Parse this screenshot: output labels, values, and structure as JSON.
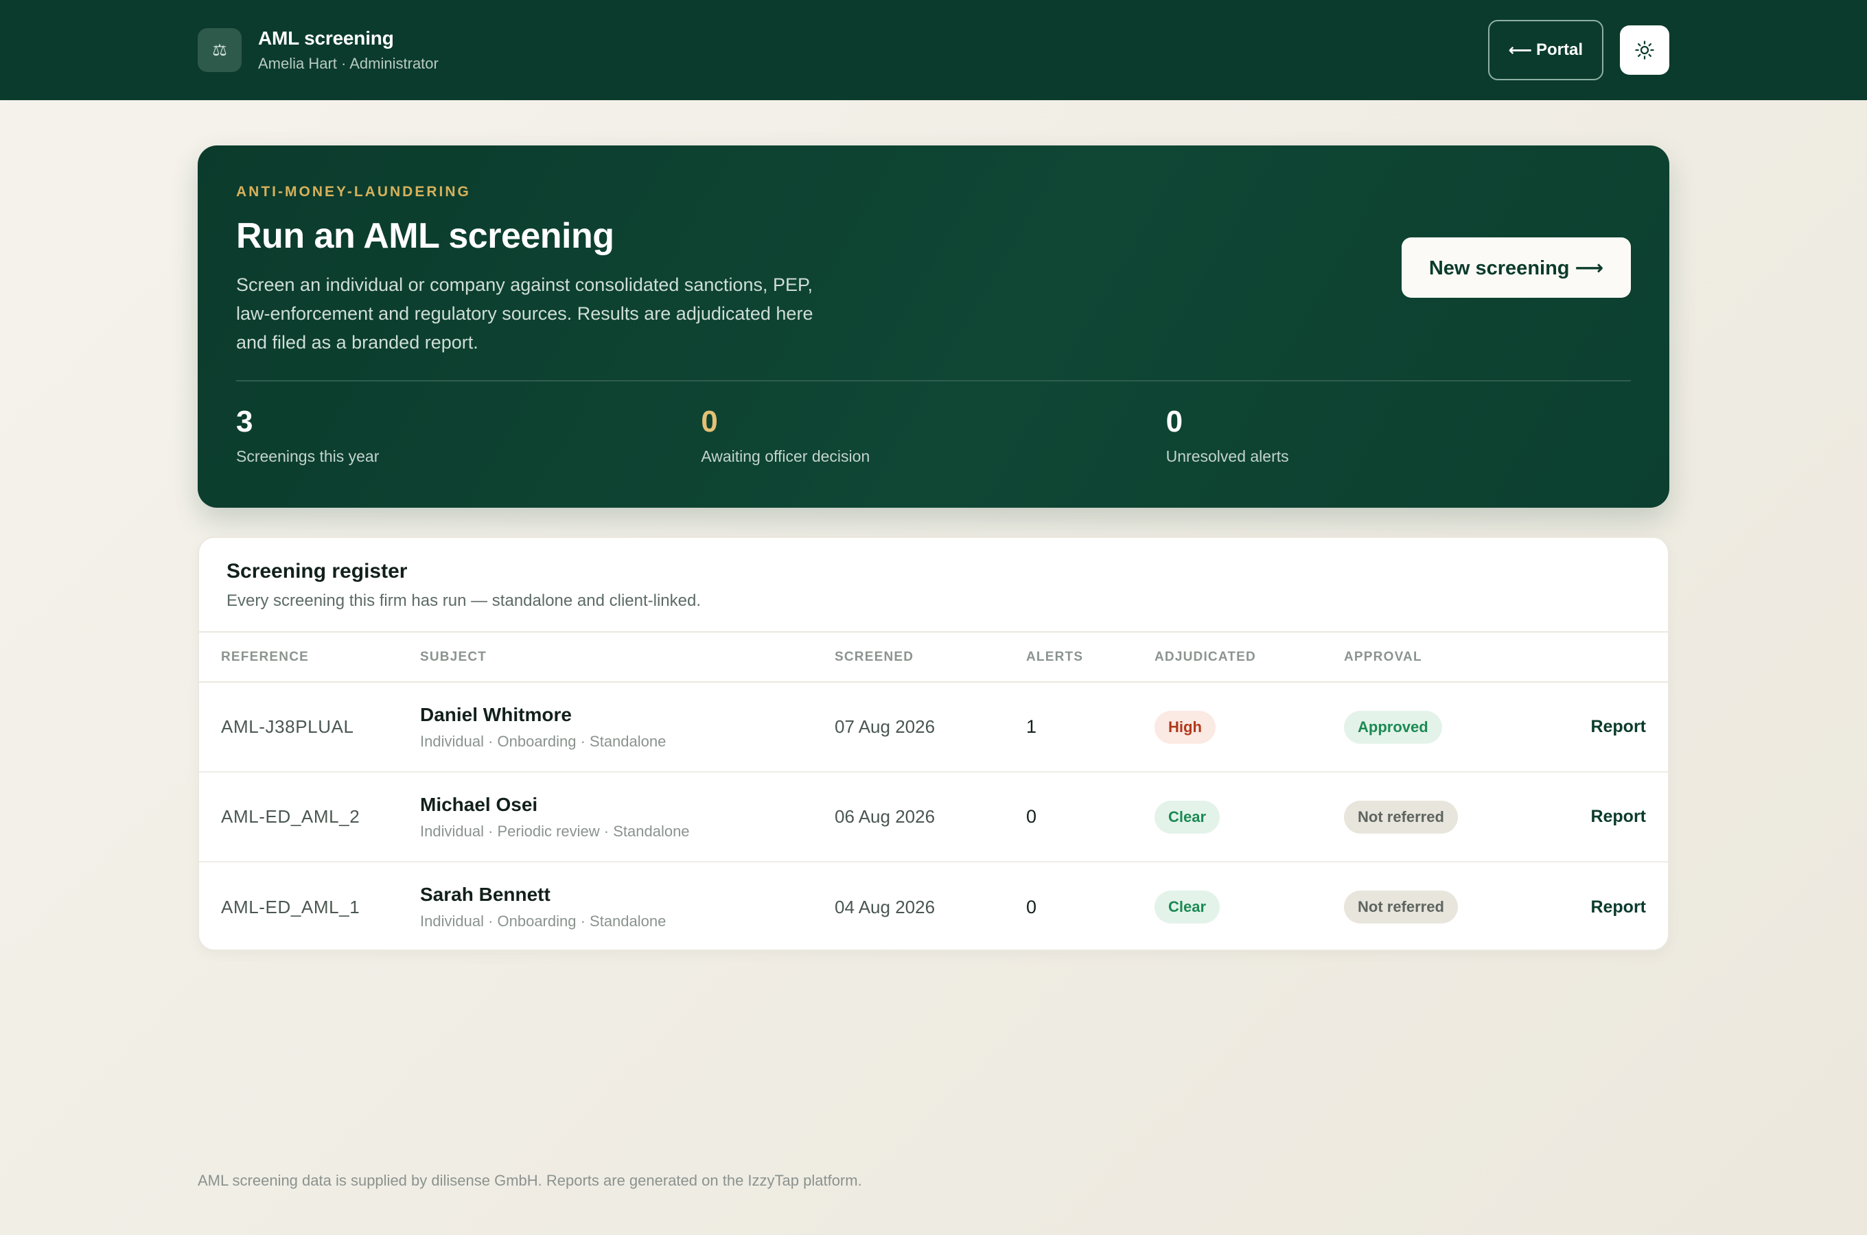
{
  "header": {
    "title": "AML screening",
    "subtitle": "Amelia Hart · Administrator",
    "badge_icon": "⚖",
    "portal_label": "Portal",
    "portal_arrow": "⟵"
  },
  "hero": {
    "eyebrow": "ANTI-MONEY-LAUNDERING",
    "title": "Run an AML screening",
    "description": "Screen an individual or company against consolidated sanctions, PEP, law-enforcement and regulatory sources. Results are adjudicated here and filed as a branded report.",
    "new_button": "New screening ⟶",
    "stats": [
      {
        "value": "3",
        "label": "Screenings this year"
      },
      {
        "value": "0",
        "label": "Awaiting officer decision"
      },
      {
        "value": "0",
        "label": "Unresolved alerts"
      }
    ]
  },
  "register": {
    "title": "Screening register",
    "subtitle": "Every screening this firm has run — standalone and client-linked.",
    "columns": [
      "REFERENCE",
      "SUBJECT",
      "SCREENED",
      "ALERTS",
      "ADJUDICATED",
      "APPROVAL"
    ],
    "rows": [
      {
        "reference": "AML-J38PLUAL",
        "name": "Daniel Whitmore",
        "meta": "Individual · Onboarding · Standalone",
        "screened": "07 Aug 2026",
        "alerts": "1",
        "adjudicated": "High",
        "approval": "Approved",
        "action": "Report"
      },
      {
        "reference": "AML-ED_AML_2",
        "name": "Michael Osei",
        "meta": "Individual · Periodic review · Standalone",
        "screened": "06 Aug 2026",
        "alerts": "0",
        "adjudicated": "Clear",
        "approval": "Not referred",
        "action": "Report"
      },
      {
        "reference": "AML-ED_AML_1",
        "name": "Sarah Bennett",
        "meta": "Individual · Onboarding · Standalone",
        "screened": "04 Aug 2026",
        "alerts": "0",
        "adjudicated": "Clear",
        "approval": "Not referred",
        "action": "Report"
      }
    ]
  },
  "footer": {
    "text": "AML screening data is supplied by dilisense GmbH. Reports are generated on the IzzyTap platform."
  },
  "colors": {
    "brand": "#0b3b2c",
    "accent_gold": "#d6b15c",
    "high": "#b0391c",
    "clear": "#1c8a53"
  }
}
